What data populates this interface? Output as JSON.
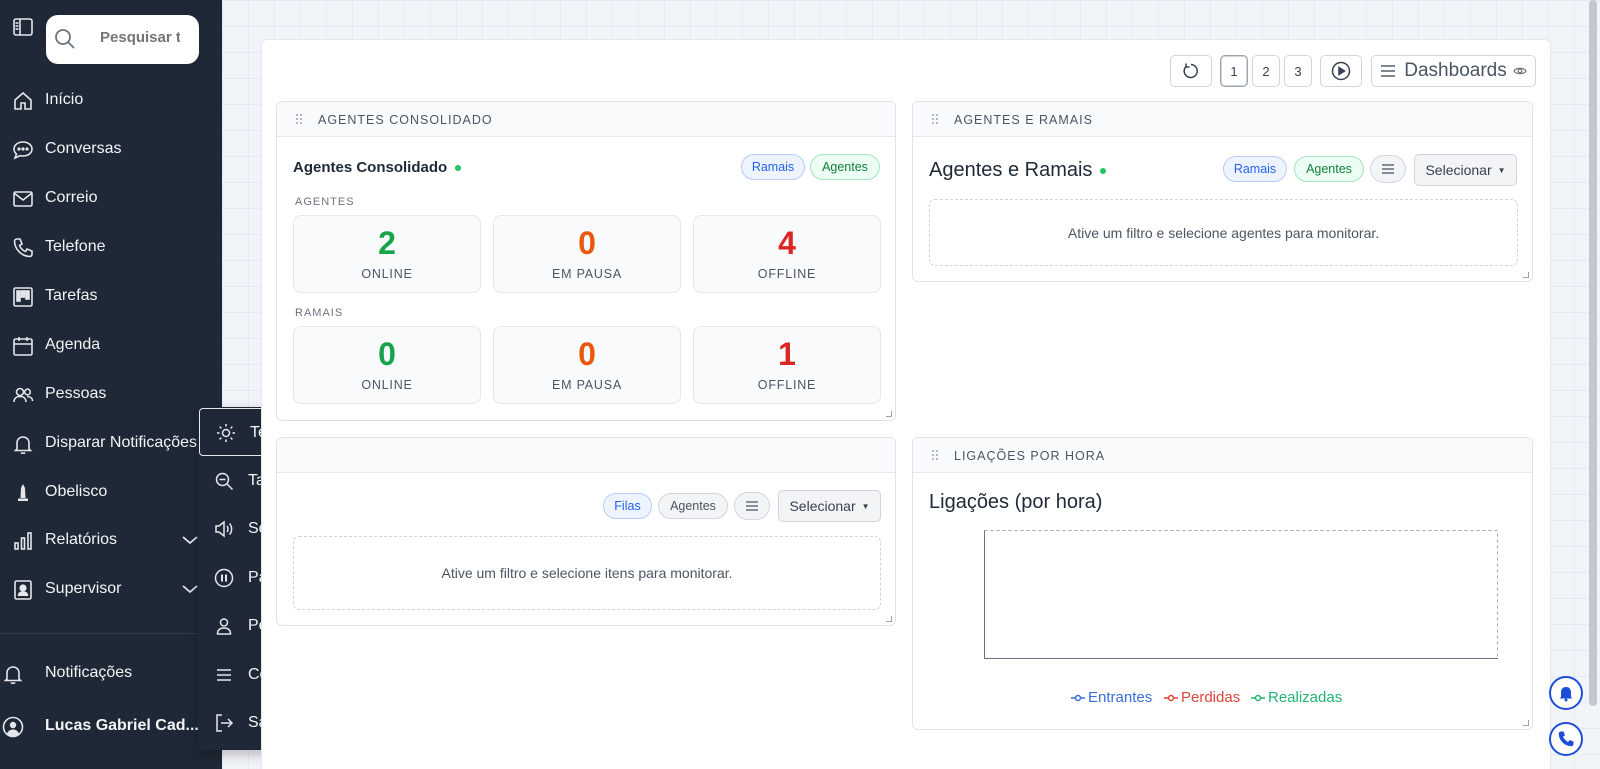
{
  "sidebar": {
    "search_placeholder": "Pesquisar t",
    "items": [
      {
        "label": "Início"
      },
      {
        "label": "Conversas"
      },
      {
        "label": "Correio"
      },
      {
        "label": "Telefone"
      },
      {
        "label": "Tarefas"
      },
      {
        "label": "Agenda"
      },
      {
        "label": "Pessoas"
      },
      {
        "label": "Disparar Notificações"
      },
      {
        "label": "Obelisco"
      },
      {
        "label": "Relatórios"
      },
      {
        "label": "Supervisor"
      }
    ],
    "notifications_label": "Notificações",
    "user_name": "Lucas Gabriel Cad..."
  },
  "popup": {
    "items": [
      {
        "label": "Tema"
      },
      {
        "label": "Tamanho"
      },
      {
        "label": "Som"
      },
      {
        "label": "Pausa"
      },
      {
        "label": "Perfil"
      },
      {
        "label": "Comandos"
      },
      {
        "label": "Sair"
      }
    ]
  },
  "toolbar": {
    "pages": [
      "1",
      "2",
      "3"
    ],
    "selected_page": "1",
    "dashboards_label": "Dashboards"
  },
  "agentes_consolidado": {
    "header": "AGENTES CONSOLIDADO",
    "title": "Agentes Consolidado",
    "pill_ramais": "Ramais",
    "pill_agentes": "Agentes",
    "section_agentes": "AGENTES",
    "section_ramais": "RAMAIS",
    "agentes_stats": [
      {
        "value": "2",
        "caption": "ONLINE"
      },
      {
        "value": "0",
        "caption": "EM PAUSA"
      },
      {
        "value": "4",
        "caption": "OFFLINE"
      }
    ],
    "ramais_stats": [
      {
        "value": "0",
        "caption": "ONLINE"
      },
      {
        "value": "0",
        "caption": "EM PAUSA"
      },
      {
        "value": "1",
        "caption": "OFFLINE"
      }
    ]
  },
  "agentes_ramais": {
    "header": "AGENTES E RAMAIS",
    "title": "Agentes e Ramais",
    "pill_ramais": "Ramais",
    "pill_agentes": "Agentes",
    "select_label": "Selecionar",
    "empty_text": "Ative um filtro e selecione agentes para monitorar."
  },
  "filas_card": {
    "pill_filas": "Filas",
    "pill_agentes": "Agentes",
    "select_label": "Selecionar",
    "empty_text": "Ative um filtro e selecione itens para monitorar."
  },
  "ligacoes": {
    "header": "LIGAÇÕES POR HORA",
    "title": "Ligações (por hora)",
    "legend": [
      {
        "label": "Entrantes",
        "color": "#3b6fd8"
      },
      {
        "label": "Perdidas",
        "color": "#e0443b"
      },
      {
        "label": "Realizadas",
        "color": "#22b573"
      }
    ]
  },
  "colors": {
    "sidebar_bg": "#1e2836",
    "online": "#16a34a",
    "pause": "#ea580c",
    "offline": "#dc2626"
  }
}
